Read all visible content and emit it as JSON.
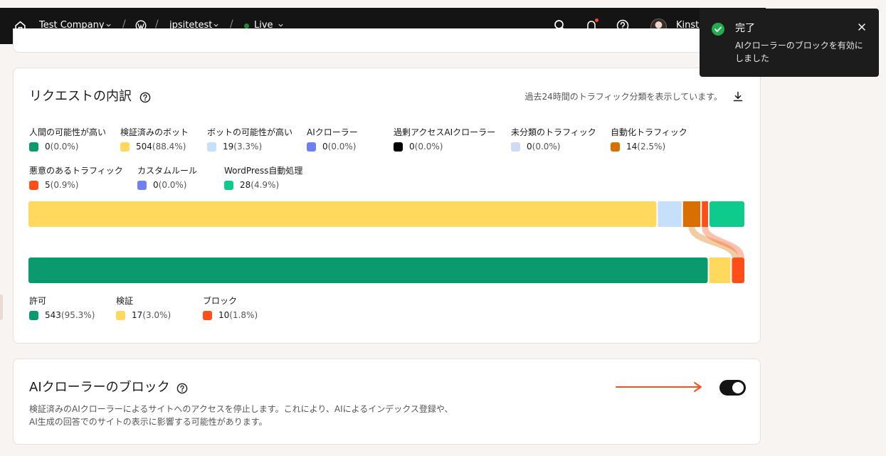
{
  "topbar": {
    "company": "Test Company",
    "site": "jpsitetest",
    "environment": "Live",
    "environment_status_color": "#1f8a3b",
    "user_name": "Kinsta",
    "icons": [
      "home-icon",
      "wordpress-icon",
      "search-icon",
      "bell-icon",
      "help-icon",
      "chevron-down-icon"
    ]
  },
  "request_breakdown": {
    "title": "リクエストの内訳",
    "subtitle": "過去24時間のトラフィック分類を表示しています。",
    "categories": [
      {
        "label": "人間の可能性が高い",
        "count": "0",
        "pct": "(0.0%)",
        "color": "#0b9a6d"
      },
      {
        "label": "検証済みのボット",
        "count": "504",
        "pct": "(88.4%)",
        "color": "#ffd95e"
      },
      {
        "label": "ボットの可能性が高い",
        "count": "19",
        "pct": "(3.3%)",
        "color": "#c6dffa"
      },
      {
        "label": "AIクローラー",
        "count": "0",
        "pct": "(0.0%)",
        "color": "#6e7ff0"
      },
      {
        "label": "過剰アクセスAIクローラー",
        "count": "0",
        "pct": "(0.0%)",
        "color": "#000000"
      },
      {
        "label": "未分類のトラフィック",
        "count": "0",
        "pct": "(0.0%)",
        "color": "#cddcf0"
      },
      {
        "label": "自動化トラフィック",
        "count": "14",
        "pct": "(2.5%)",
        "color": "#d86f00"
      },
      {
        "label": "悪意のあるトラフィック",
        "count": "5",
        "pct": "(0.9%)",
        "color": "#ff4e17"
      },
      {
        "label": "カスタムルール",
        "count": "0",
        "pct": "(0.0%)",
        "color": "#6e7ff0"
      },
      {
        "label": "WordPress自動処理",
        "count": "28",
        "pct": "(4.9%)",
        "color": "#0dcb8c"
      }
    ],
    "outcomes": [
      {
        "label": "許可",
        "count": "543",
        "pct": "(95.3%)",
        "color": "#0b9a6d"
      },
      {
        "label": "検証",
        "count": "17",
        "pct": "(3.0%)",
        "color": "#ffd95e"
      },
      {
        "label": "ブロック",
        "count": "10",
        "pct": "(1.8%)",
        "color": "#ff4e17"
      }
    ]
  },
  "ai_block": {
    "title": "AIクローラーのブロック",
    "description": "検証済みのAIクローラーによるサイトへのアクセスを停止します。これにより、AIによるインデックス登録や、AI生成の回答でのサイトの表示に影響する可能性があります。",
    "toggle_on": true
  },
  "toast": {
    "title": "完了",
    "message": "AIクローラーのブロックを有効にしました"
  }
}
